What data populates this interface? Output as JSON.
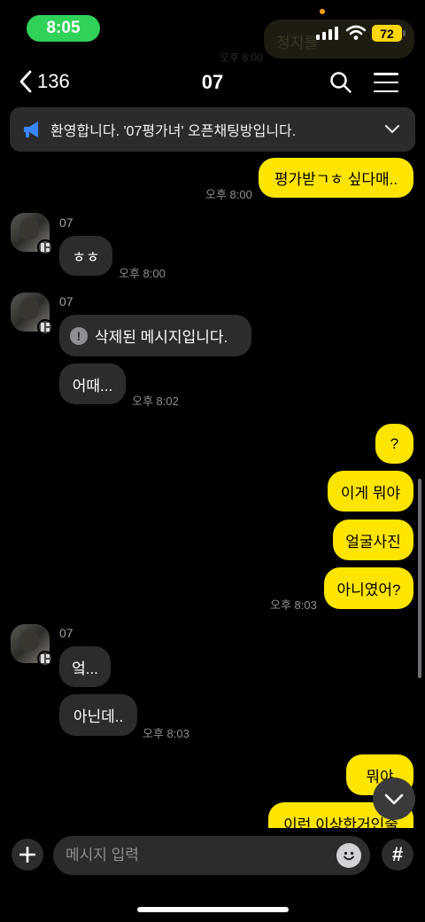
{
  "status": {
    "time": "8:05",
    "battery": "72"
  },
  "ghost": {
    "text": "정지를",
    "time": "오후 8:00"
  },
  "header": {
    "back_count": "136",
    "title": "07"
  },
  "notice": {
    "text": "환영합니다. '07평가녀' 오픈채팅방입니다."
  },
  "messages": {
    "m1": {
      "text": "평가받ㄱㅎ 싶다매..",
      "time": "오후 8:00"
    },
    "g1": {
      "sender": "07",
      "text": "ㅎㅎ",
      "time": "오후 8:00"
    },
    "g2": {
      "sender": "07",
      "deleted_text": "삭제된 메시지입니다.",
      "text": "어때...",
      "time": "오후 8:02"
    },
    "m2": {
      "items": [
        "?",
        "이게 뭐야",
        "얼굴사진",
        "아니였어?"
      ],
      "time": "오후 8:03"
    },
    "g3": {
      "sender": "07",
      "items": [
        "엌...",
        "아닌데.."
      ],
      "time": "오후 8:03"
    },
    "m3": {
      "items": [
        "뭐야",
        "이런 이상한거인줄"
      ]
    }
  },
  "input": {
    "placeholder": "메시지 입력"
  },
  "colors": {
    "my_bubble": "#fee500",
    "their_bubble": "#2c2c2e",
    "status_pill": "#30d158",
    "battery": "#ffd60a"
  }
}
